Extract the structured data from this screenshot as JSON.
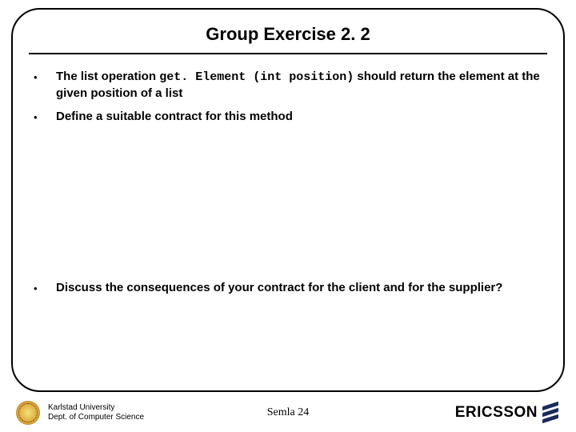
{
  "title": "Group Exercise 2. 2",
  "bullets": {
    "b1_pre": "The list operation ",
    "b1_code": "get. Element (int position)",
    "b1_post": " should return the element at the given position of a list",
    "b2": "Define a suitable contract for this method",
    "b3": "Discuss the consequences of your contract for the client and for the supplier?"
  },
  "footer": {
    "uni_line1": "Karlstad University",
    "uni_line2": "Dept. of Computer Science",
    "slide_number": "Semla 24",
    "brand": "ERICSSON"
  }
}
